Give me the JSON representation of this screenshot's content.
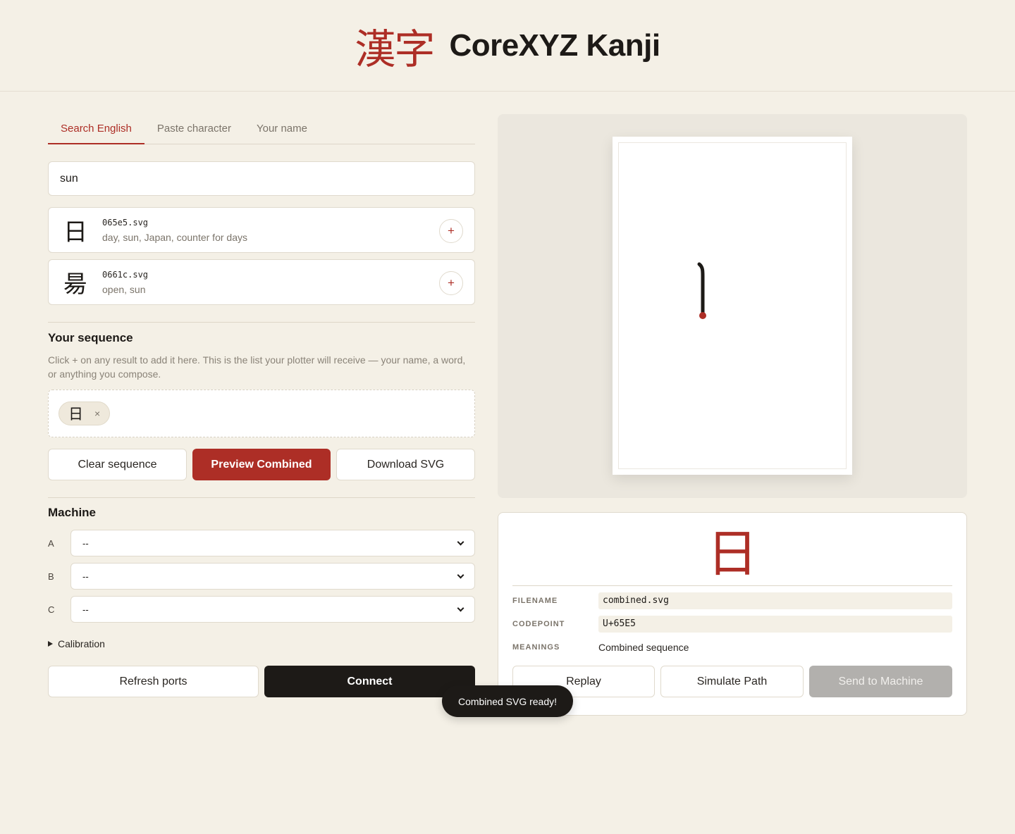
{
  "header": {
    "glyph": "漢字",
    "title": "CoreXYZ Kanji"
  },
  "tabs": [
    {
      "label": "Search English",
      "active": true
    },
    {
      "label": "Paste character",
      "active": false
    },
    {
      "label": "Your name",
      "active": false
    }
  ],
  "search": {
    "value": "sun"
  },
  "results": [
    {
      "glyph": "日",
      "file": "065e5.svg",
      "meanings": "day, sun, Japan, counter for days",
      "add": "+"
    },
    {
      "glyph": "昜",
      "file": "0661c.svg",
      "meanings": "open, sun",
      "add": "+"
    }
  ],
  "sequence": {
    "title": "Your sequence",
    "help": "Click + on any result to add it here. This is the list your plotter will receive — your name, a word, or anything you compose.",
    "items": [
      {
        "glyph": "日",
        "remove": "×"
      }
    ],
    "clear_label": "Clear sequence",
    "preview_label": "Preview Combined",
    "download_label": "Download SVG"
  },
  "machine": {
    "title": "Machine",
    "ports": [
      {
        "label": "A",
        "value": "--"
      },
      {
        "label": "B",
        "value": "--"
      },
      {
        "label": "C",
        "value": "--"
      }
    ],
    "calibration_label": "Calibration",
    "refresh_label": "Refresh ports",
    "connect_label": "Connect"
  },
  "detail": {
    "glyph": "日",
    "filename_label": "FILENAME",
    "filename": "combined.svg",
    "codepoint_label": "CODEPOINT",
    "codepoint": "U+65E5",
    "meanings_label": "MEANINGS",
    "meanings": "Combined sequence",
    "replay_label": "Replay",
    "simulate_label": "Simulate Path",
    "send_label": "Send to Machine"
  },
  "toast": "Combined SVG ready!",
  "colors": {
    "accent": "#ad2e26",
    "background": "#f4f0e6",
    "dark": "#1d1a17",
    "disabled": "#b2b0ad"
  }
}
